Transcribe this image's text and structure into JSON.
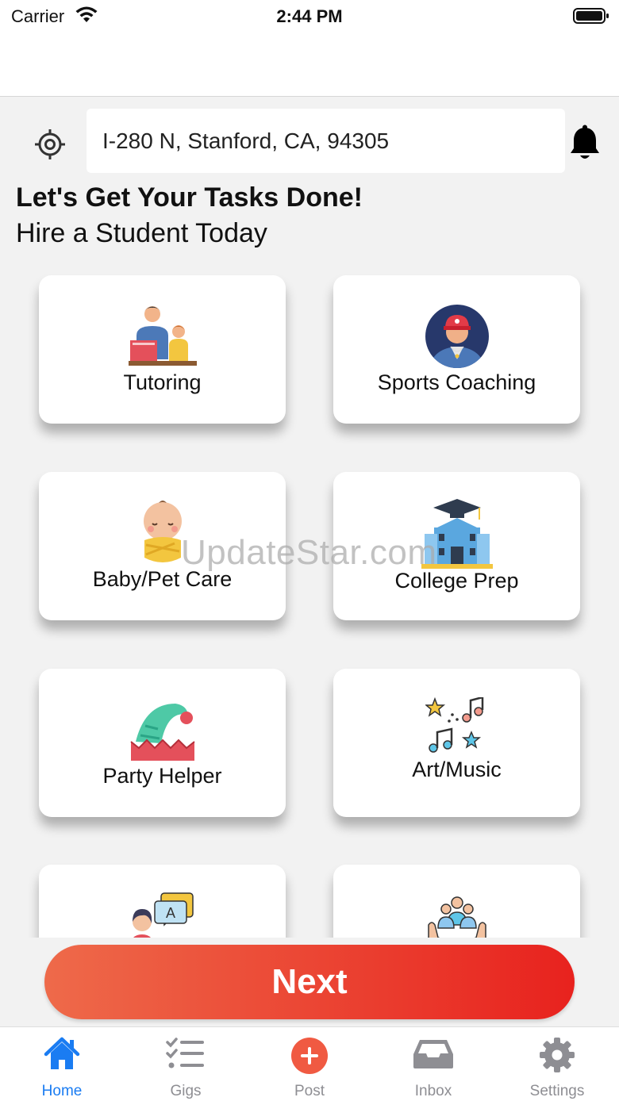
{
  "status_bar": {
    "carrier": "Carrier",
    "time": "2:44 PM"
  },
  "location": {
    "address": "I-280 N, Stanford, CA, 94305"
  },
  "header": {
    "title": "Let's Get Your Tasks Done!",
    "subtitle": "Hire a Student Today"
  },
  "categories": [
    {
      "label": "Tutoring",
      "icon": "tutoring-icon"
    },
    {
      "label": "Sports Coaching",
      "icon": "sports-coach-icon"
    },
    {
      "label": "Baby/Pet Care",
      "icon": "baby-icon"
    },
    {
      "label": "College Prep",
      "icon": "college-icon"
    },
    {
      "label": "Party Helper",
      "icon": "party-hat-icon"
    },
    {
      "label": "Art/Music",
      "icon": "music-notes-icon"
    },
    {
      "label": "",
      "icon": "language-chat-icon"
    },
    {
      "label": "",
      "icon": "group-icon"
    }
  ],
  "watermark": "UpdateStar.com",
  "next_button": {
    "label": "Next"
  },
  "tab_bar": {
    "items": [
      {
        "label": "Home",
        "icon": "home-icon",
        "active": true
      },
      {
        "label": "Gigs",
        "icon": "checklist-icon",
        "active": false
      },
      {
        "label": "Post",
        "icon": "plus-circle-icon",
        "active": false
      },
      {
        "label": "Inbox",
        "icon": "inbox-tray-icon",
        "active": false
      },
      {
        "label": "Settings",
        "icon": "gear-icon",
        "active": false
      }
    ]
  },
  "colors": {
    "accent": "#1a7cf2",
    "button_start": "#ee6a4a",
    "button_end": "#e8221e",
    "post": "#f05a42"
  }
}
